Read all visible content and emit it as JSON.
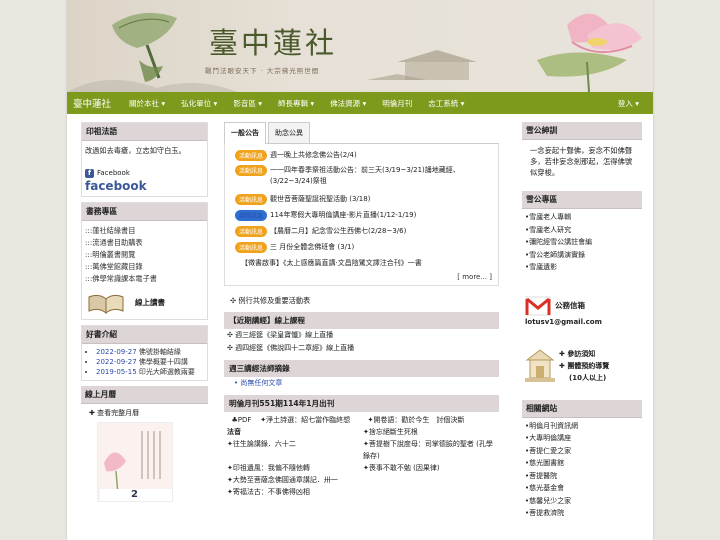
{
  "banner": {
    "title": "臺中蓮社",
    "motto": "戰鬥法眼安天下 · 大宗佛光照世間"
  },
  "nav": {
    "brand": "臺中蓮社",
    "items": [
      "關於本社 ▾",
      "弘化單位 ▾",
      "影音區 ▾",
      "師長專輯 ▾",
      "佛法資源 ▾",
      "明倫月刊",
      "志工系統 ▾"
    ],
    "login": "登入 ▾"
  },
  "left": {
    "box1": {
      "title": "印祖法語",
      "text": "改過如去毒瘡，立志如守白玉。",
      "fb_label": "Facebook",
      "fb_word": "facebook"
    },
    "box2": {
      "title": "書務專區",
      "links": [
        ":::蓮社結緣書目",
        ":::流通書目助購表",
        ":::明倫叢書閱覽",
        ":::萬佛堂館藏目錄",
        ":::佛學常識課本電子書"
      ],
      "online": "線上讀書"
    },
    "box3": {
      "title": "好書介紹",
      "items": [
        {
          "date": "2022-09-27",
          "text": "佛號掛軸結緣"
        },
        {
          "date": "2022-09-27",
          "text": "佛學概要十四講"
        },
        {
          "date": "2019-05-15",
          "text": "印光大師選教兩要"
        }
      ]
    },
    "box4": {
      "title": "線上月曆",
      "link": "查看完整月曆",
      "cal_num": "2"
    }
  },
  "mid": {
    "tabs": [
      "一般公告",
      "助念公異"
    ],
    "announcements": [
      {
        "badge": "活動訊息",
        "text": "週一晚上共修念佛公告(2/4)",
        "badge_color": "orange"
      },
      {
        "badge": "活動訊息",
        "text": "一一四年春季祭祖活動公告：前三天(3/19~3/21)誦地藏經、(3/22~3/24)祭祖",
        "badge_color": "orange"
      },
      {
        "badge": "活動訊息",
        "text": "觀世音菩薩聖誕祝聖活動 (3/18)",
        "badge_color": "orange"
      },
      {
        "badge": "課程訊息",
        "text": "114年寒假大專明倫講座-影片直播(1/12-1/19)",
        "badge_color": "blue"
      },
      {
        "badge": "活動訊息",
        "text": "【農曆二月】紀念雪公生西佛七(2/28~3/6)",
        "badge_color": "orange"
      },
      {
        "badge": "活動訊息",
        "text": "三 月份全體念佛班會 (3/1)",
        "badge_color": "orange"
      }
    ],
    "story": "【徵書啟事】《太上感應篇直講·文昌陰騭文譯注合刊》一書",
    "more": "[ more... ]",
    "routine": "例行共修及重要活動表",
    "courses_title": "【近期講經】線上課程",
    "courses": [
      "週三經筵《梁皇寶懺》線上直播",
      "週四經筵《佛說四十二章經》線上直播"
    ],
    "weekly_title": "週三講經法師摘錄",
    "weekly_item": "尚無任何文章",
    "monthly_title": "明倫月刊551期114年1月出刊",
    "monthly_pdf": "PDF",
    "monthly_cols": [
      [
        "淨土詩選：紹七當作臨終想",
        "開卷語：勸於今生　討個決斷"
      ],
      [
        "法音",
        "捨忘絕斷生死根"
      ]
    ],
    "monthly_rows": [
      [
        "往生論講錄．六十二",
        "菩提樹下說度母：司掌德臉的聖者 (孔學錄存)"
      ],
      [
        "印祖遺風：我偏不隨他轉",
        "喪事不敢不勉 (因果律)"
      ],
      [
        "大勢至菩薩念佛圓通章講記．卅一",
        ""
      ],
      [
        "寄福法古：不事佛得凶相",
        ""
      ]
    ]
  },
  "right": {
    "b1": {
      "title": "雪公紳訓",
      "text": "一念妄起十聲佛，妄念不如佛聲多，若非妄念剎那起，怎得佛號似穿梭。"
    },
    "b2": {
      "title": "雪公專區",
      "links": [
        "雪廬老人專輯",
        "雪廬老人研究",
        "彌陀經雪公講註會編",
        "雪公老師講演實錄",
        "雪廬遺影"
      ]
    },
    "mail_label": "公務信箱",
    "email": "lotusv1@gmail.com",
    "visit": [
      "參訪須知",
      "團體預約導覽",
      "(10人以上)"
    ],
    "b3": {
      "title": "相關網站",
      "links": [
        "明倫月刊資訊網",
        "大專明倫講座",
        "菩提仁愛之家",
        "慈光圖書館",
        "菩提醫院",
        "慈光基金會",
        "慈馨兒少之家",
        "菩提救濟院"
      ]
    }
  }
}
